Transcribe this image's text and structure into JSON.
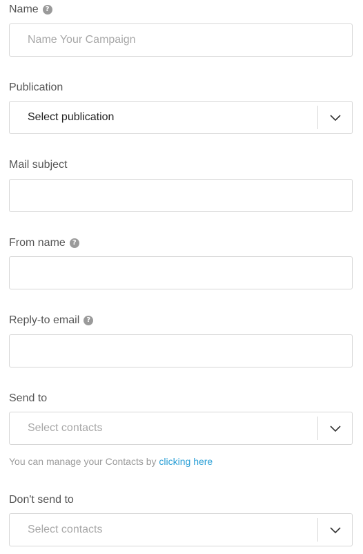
{
  "name": {
    "label": "Name",
    "placeholder": "Name Your Campaign",
    "help": "?"
  },
  "publication": {
    "label": "Publication",
    "selected": "Select publication"
  },
  "mail_subject": {
    "label": "Mail subject",
    "value": ""
  },
  "from_name": {
    "label": "From name",
    "value": "",
    "help": "?"
  },
  "reply_to": {
    "label": "Reply-to email",
    "value": "",
    "help": "?"
  },
  "send_to": {
    "label": "Send to",
    "placeholder": "Select contacts"
  },
  "contacts_hint": {
    "text": "You can manage your Contacts by ",
    "link": "clicking here"
  },
  "dont_send_to": {
    "label": "Don't send to",
    "placeholder": "Select contacts"
  }
}
